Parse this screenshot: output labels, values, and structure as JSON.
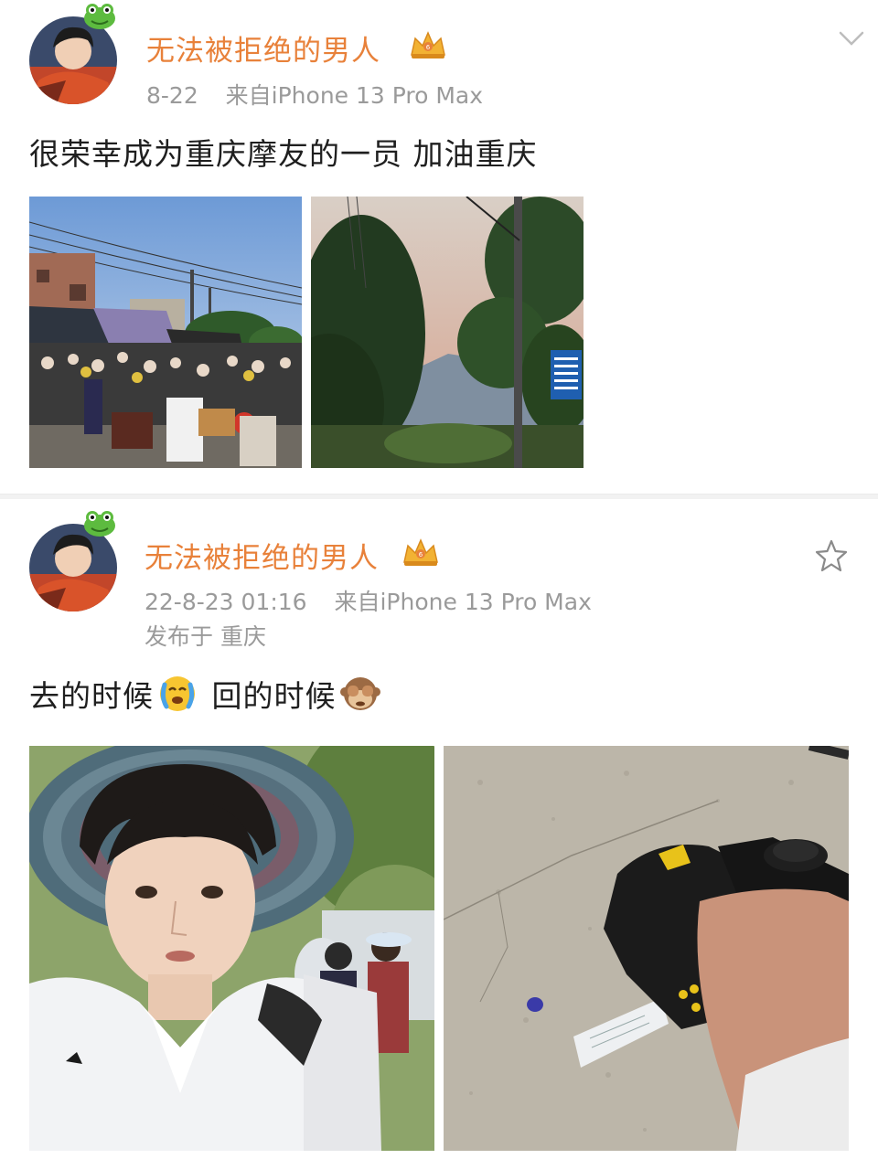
{
  "post1": {
    "username": "无法被拒绝的男人",
    "date": "8-22",
    "source": "来自iPhone 13 Pro Max",
    "text": "很荣幸成为重庆摩友的一员 加油重庆"
  },
  "post2": {
    "username": "无法被拒绝的男人",
    "date": "22-8-23 01:16",
    "source": "来自iPhone 13 Pro Max",
    "location": "发布于 重庆",
    "text_part1": "去的时候",
    "text_part2": "回的时候"
  },
  "icons": {
    "vip": "crown-vip-icon",
    "expand": "chevron-down-icon",
    "favorite": "star-outline-icon",
    "emoji1": "crying-emoji-icon",
    "emoji2": "see-no-evil-monkey-icon"
  },
  "colors": {
    "username": "#e8813a",
    "meta": "#9a9a9a",
    "text": "#1f1f1f"
  }
}
